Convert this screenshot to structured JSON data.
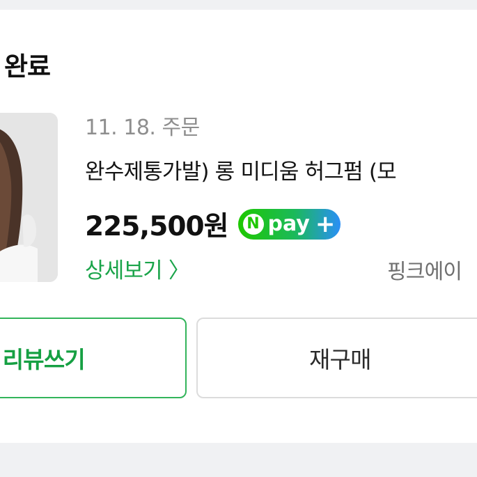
{
  "order_card": {
    "status_title": "완료",
    "order_date": "11. 18. 주문",
    "product_name": "완수제통가발) 롱 미디움 허그펌 (모",
    "price": "225,500원",
    "npay": {
      "n_letter": "N",
      "label": "pay",
      "plus": "+"
    },
    "detail_link": "상세보기 〉",
    "seller_name": "핑크에이",
    "buttons": {
      "review": "리뷰쓰기",
      "rebuy": "재구매"
    }
  },
  "colors": {
    "accent_green": "#1aa44a",
    "review_border": "#32b45a",
    "background": "#f0f1f3"
  }
}
